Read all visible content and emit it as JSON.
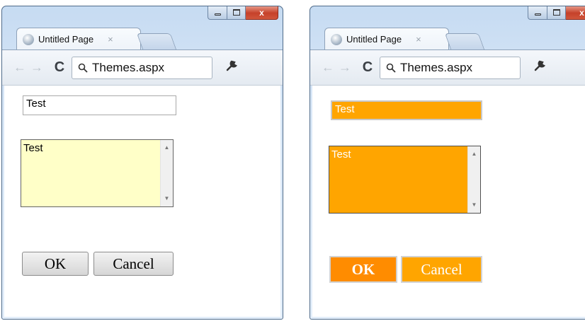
{
  "windows": [
    {
      "tab_title": "Untitled Page",
      "tab_close": "×",
      "close_glyph": "x",
      "address": "Themes.aspx",
      "textbox_value": "Test",
      "listbox_item": "Test",
      "ok_label": "OK",
      "cancel_label": "Cancel",
      "theme": {
        "textbox_bg": "#ffffff",
        "textbox_fg": "#000000",
        "listbox_bg": "#ffffc8",
        "listbox_fg": "#000000",
        "button_bg": "#e6e6e6",
        "button_fg": "#000000"
      }
    },
    {
      "tab_title": "Untitled Page",
      "tab_close": "×",
      "close_glyph": "x",
      "address": "Themes.aspx",
      "textbox_value": "Test",
      "listbox_item": "Test",
      "ok_label": "OK",
      "cancel_label": "Cancel",
      "theme": {
        "textbox_bg": "#ffa500",
        "textbox_fg": "#ffffff",
        "listbox_bg": "#ffa500",
        "listbox_fg": "#ffffff",
        "button_bg": "#ff8c00",
        "button_fg": "#ffffff",
        "cancel_bg": "#ffa500"
      }
    }
  ]
}
